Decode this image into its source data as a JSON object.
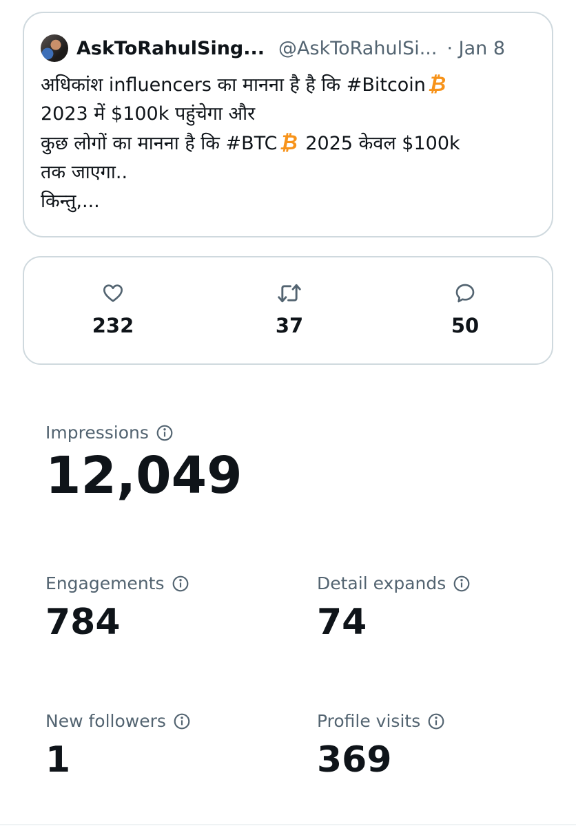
{
  "tweet": {
    "author_name": "AskToRahulSing...",
    "handle": "@AskToRahulSi...",
    "date": "· Jan 8",
    "text": {
      "line1_pre": "अधिकांश influencers का मानना है है कि #Bitcoin",
      "line2": "2023 में $100k पहुंचेगा और",
      "line3_pre": "कुछ लोगों का मानना है कि #BTC",
      "line3_post": "2025 केवल $100k",
      "line4": "तक जाएगा..",
      "line5": "किन्तु,..."
    },
    "bitcoin_symbol": "₿"
  },
  "engagement": {
    "likes": "232",
    "retweets": "37",
    "replies": "50"
  },
  "metrics": {
    "impressions": {
      "label": "Impressions",
      "value": "12,049"
    },
    "engagements": {
      "label": "Engagements",
      "value": "784"
    },
    "detail_expands": {
      "label": "Detail expands",
      "value": "74"
    },
    "new_followers": {
      "label": "New followers",
      "value": "1"
    },
    "profile_visits": {
      "label": "Profile visits",
      "value": "369"
    }
  },
  "colors": {
    "text": "#0f1419",
    "secondary": "#536471",
    "border": "#cfd9de",
    "bitcoin": "#f7931a"
  }
}
